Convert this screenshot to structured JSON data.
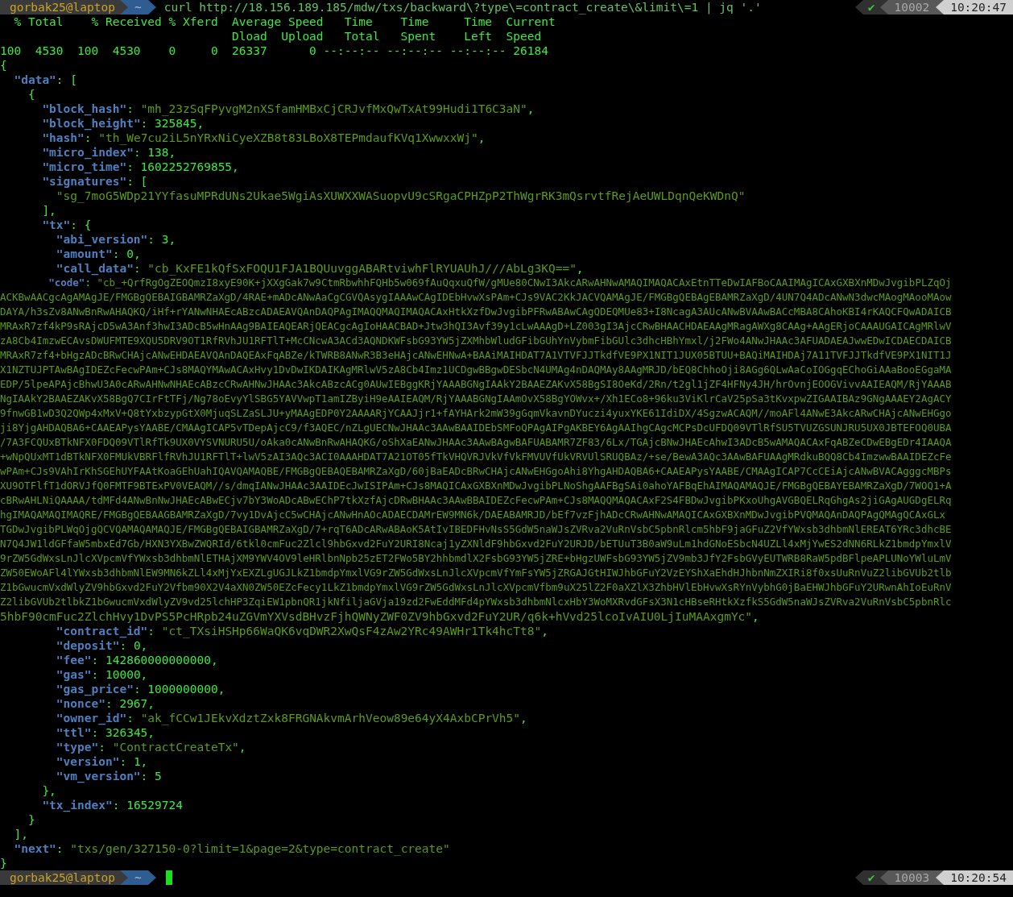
{
  "terminal": {
    "lines": [
      {
        "kind": "prompt",
        "user": "gorbak25@laptop",
        "cwd": "~",
        "command": "curl http://18.156.189.185/mdw/txs/backward\\?type\\=contract_create\\&limit\\=1 | jq '.'",
        "status_icon": "✔",
        "history_number": "10002",
        "time": "10:20:47",
        "cursor": false
      },
      {
        "kind": "output",
        "segments": [
          {
            "kind": "text",
            "text": "  % Total    % Received % Xferd  Average Speed   Time    Time     Time  Current"
          }
        ]
      },
      {
        "kind": "output",
        "segments": [
          {
            "kind": "text",
            "text": "                                 Dload  Upload   Total   Spent    Left  Speed"
          }
        ]
      },
      {
        "kind": "output",
        "segments": [
          {
            "kind": "text",
            "text": "100  4530  100  4530    0     0  26337      0 --:--:-- --:--:-- --:--:-- 26184"
          }
        ]
      },
      {
        "kind": "output",
        "segments": [
          {
            "kind": "text",
            "text": "{"
          }
        ]
      },
      {
        "kind": "output",
        "segments": [
          {
            "kind": "key",
            "text": "  \"data\""
          },
          {
            "kind": "text",
            "text": ": ["
          }
        ]
      },
      {
        "kind": "output",
        "segments": [
          {
            "kind": "text",
            "text": "    {"
          }
        ]
      },
      {
        "kind": "output",
        "segments": [
          {
            "kind": "key",
            "text": "      \"block_hash\""
          },
          {
            "kind": "text",
            "text": ": "
          },
          {
            "kind": "string",
            "text": "\"mh_23zSqFPyvgM2nXSfamHMBxCjCRJvfMxQwTxAt99Hudi1T6C3aN\""
          },
          {
            "kind": "text",
            "text": ","
          }
        ]
      },
      {
        "kind": "output",
        "segments": [
          {
            "kind": "key",
            "text": "      \"block_height\""
          },
          {
            "kind": "text",
            "text": ": 325845,"
          }
        ]
      },
      {
        "kind": "output",
        "segments": [
          {
            "kind": "key",
            "text": "      \"hash\""
          },
          {
            "kind": "text",
            "text": ": "
          },
          {
            "kind": "string",
            "text": "\"th_We7cu2iL5nYRxNiCyeXZB8t83LBoX8TEPmdaufKVq1XwwxxWj\""
          },
          {
            "kind": "text",
            "text": ","
          }
        ]
      },
      {
        "kind": "output",
        "segments": [
          {
            "kind": "key",
            "text": "      \"micro_index\""
          },
          {
            "kind": "text",
            "text": ": 138,"
          }
        ]
      },
      {
        "kind": "output",
        "segments": [
          {
            "kind": "key",
            "text": "      \"micro_time\""
          },
          {
            "kind": "text",
            "text": ": 1602252769855,"
          }
        ]
      },
      {
        "kind": "output",
        "segments": [
          {
            "kind": "key",
            "text": "      \"signatures\""
          },
          {
            "kind": "text",
            "text": ": ["
          }
        ]
      },
      {
        "kind": "output",
        "segments": [
          {
            "kind": "string",
            "text": "        \"sg_7moG5WDp21YYfasuMPRdUNs2Ukae5WgiAsXUWXXWASuopvU9cSRgaCPHZpP2ThWgrRK3mQsrvtfRejAeUWLDqnQeKWDnQ\""
          }
        ]
      },
      {
        "kind": "output",
        "segments": [
          {
            "kind": "text",
            "text": "      ],"
          }
        ]
      },
      {
        "kind": "output",
        "segments": [
          {
            "kind": "key",
            "text": "      \"tx\""
          },
          {
            "kind": "text",
            "text": ": {"
          }
        ]
      },
      {
        "kind": "output",
        "segments": [
          {
            "kind": "key",
            "text": "        \"abi_version\""
          },
          {
            "kind": "text",
            "text": ": 3,"
          }
        ]
      },
      {
        "kind": "output",
        "segments": [
          {
            "kind": "key",
            "text": "        \"amount\""
          },
          {
            "kind": "text",
            "text": ": 0,"
          }
        ]
      },
      {
        "kind": "output",
        "segments": [
          {
            "kind": "key",
            "text": "        \"call_data\""
          },
          {
            "kind": "text",
            "text": ": "
          },
          {
            "kind": "string",
            "text": "\"cb_KxFE1kQfSxFOQU1FJA1BQUuvggABARtviwhFlRYUAUhJ///AbLg3KQ==\""
          },
          {
            "kind": "text",
            "text": ","
          }
        ]
      },
      {
        "kind": "output",
        "segments": [
          {
            "kind": "key",
            "text": "        \"code\""
          },
          {
            "kind": "text",
            "text": ": "
          },
          {
            "kind": "string",
            "text": "\"cb_+QrfRgOgZEOQmzI8xyE90K+jXXgGak7w9CtmRbwhhFQHb5w069fAuQqxuQfW/gMUe80CNwI3AkcARwAHNwAMAQIMAQACAxEtnTTeDwIAFBoCAAIMAgICAxGXBXnMDwJvgibPLZqOj"
          }
        ]
      },
      {
        "kind": "output",
        "segments": [
          {
            "kind": "string",
            "text": "ACKBwAACgcAgAMAgJE/FMGBgQEBAIGBAMRZaXgD/4RAE+mADcANwAaCgCGVQAsygIAAAwCAgIDEbHvwXsPAm+CJs9VAC2KkJACVQAMAgJE/FMGBgQEBAgEBAMRZaXgD/4UN7Q4ADcANwN3dwcMAogMAooMAow"
          }
        ]
      },
      {
        "kind": "output",
        "segments": [
          {
            "kind": "string",
            "text": "DAYA/h3sZv8ANwBnRwAHAQKQ/iHf+rYANwNHAEcABzcADAEAVQAnDAQPAgIMAQQMAQIMAQACAxHtkXzfDwJvgibPFRwABAwCAgQDEQMUe83+I8NcagA3AUcANwBVAAwBACcMBA8CAhoKBI4rKAQCFQwADAICB"
          }
        ]
      },
      {
        "kind": "output",
        "segments": [
          {
            "kind": "string",
            "text": "MRAxR7zf4kP9sRAjcD5wA3Anf3hwI3ADcB5wHnAAg9BAIEAQEARjQEACgcAgIoHAACBAD+Jtw3hQI3Avf39y1cLwAAAgD+LZ003gI3AjcCRwBHAACHDAEAAgMRagAWXg8CAAg+AAgERjoCAAAUGAICAgMRlwV"
          }
        ]
      },
      {
        "kind": "output",
        "segments": [
          {
            "kind": "string",
            "text": "zA8Cb4ImzwECAvsDWUFMTE9XQU5DRV9OT1RfRVhJU1RFTlT+McCNcwA3ACd3AQNDKWFsbG93YW5jZXMhbWludGFibGUhYnVybmFibGUlc3dhcHBhYmxl/j2FWo4ANwJHAAc3AFUADAEAJwwEDwICDAECDAICB"
          }
        ]
      },
      {
        "kind": "output",
        "segments": [
          {
            "kind": "string",
            "text": "MRAxR7zf4+bHgzADcBRwCHAjcANwEHDAEAVQAnDAQEAxFqABZe/kTWRB8ANwR3B3eHAjcANwEHNwA+BAAiMAIHDAT7A1VTVFJJTkdfVE9PX1NIT1JUX05BTUU+BAQiMAIHDAj7A11TVFJJTkdfVE9PX1NIT1J"
          }
        ]
      },
      {
        "kind": "output",
        "segments": [
          {
            "kind": "string",
            "text": "X1NZTUJPTAwBAgIDEZcFecwPAm+CJs8MAQYMAwACAxHvy1DvDwIKDAIKAgMRlwV5zA8Cb4Imz1UCDgwBBgwDESbcN4UMAg4nDAQMAy8AAgMRJD/bEQ8ChhoOji8AGg6QLwAaCoIOGgqEChoGiAAaBooEGgaMA"
          }
        ]
      },
      {
        "kind": "output",
        "segments": [
          {
            "kind": "string",
            "text": "EDP/5lpeAPAjcBhwU3A0cARwAHNwNHAEcABzcCRwAHNwJHAAc3AkcABzcACg0AUwIEBggKRjYAAABGNgIAAkY2BAAEZAKvX58BgSI8OeKd/2Rn/t2gl1jZF4HFNy4JH/hrOvnjEOOGVivvAAIEAQM/RjYAAAB"
          }
        ]
      },
      {
        "kind": "output",
        "segments": [
          {
            "kind": "string",
            "text": "NgIAAkY2BAAEZAKvX58BgQ7CIrFtTFj/Ng78oEvyYlSBG5YAVVwpT1amIZByiH9eAAIEAQM/RjYAAABGNgIAAmOvX58BgYOWvx+/Xh1ECo8+96ku3ViKlrCaV25pSa3tKvxpwZIGAAIBAz9GNgAAAEY2AgACY"
          }
        ]
      },
      {
        "kind": "output",
        "segments": [
          {
            "kind": "string",
            "text": "9fnwGB1wD3Q2QWp4xMxV+Q8tYxbzypGtX0MjuqSLZaSLJU+yMAAgEDP0Y2AAAARjYCAAJjr1+fAYHArk2mW39gGqmVkavnDYuczi4yuxYKE61IdiDX/4SgzwACAQM//moAFl4ANwE3AkcARwCHAjcANwEHGgo"
          }
        ]
      },
      {
        "kind": "output",
        "segments": [
          {
            "kind": "string",
            "text": "ji8YjgAHDAQBA6+CAAEAPysYAABE/CMAAgICAP5vTDepAjcC9/f3AQEC/nZLgUECNwJHAAc3AAwBAAIDEbSMFoQPAgAIPgAKBEY6AgAAIhgCAgcMCPsDcUFDQ09VTlRfSU5TVUZGSUNJRU5UX0JBTEFOQ0UBA"
          }
        ]
      },
      {
        "kind": "output",
        "segments": [
          {
            "kind": "string",
            "text": "/7A3FCQUxBTkNFX0FDQ09VTlRfTk9UX0VYSVNURU5U/oAka0cANwBnRwAHAQKG/oShXaEANwJHAAc3AAwBAgwBAFUABAMR7ZF83/6Lx/TGAjcBNwJHAEcAhwI3ADcB5wAMAQACAxFqABZeCDwEBgEDr4IAAQA"
          }
        ]
      },
      {
        "kind": "output",
        "segments": [
          {
            "kind": "string",
            "text": "+wNpQUxMT1dBTkNFX0FMUkVBRFlfRVhJU1RFTlT+lwV5zAI3AQc3ACI0AAAHDAT7A21OT05fTkVHQVRJVkVfVkFMVUVfUkVRVUlSRUQBAz/+se/BewA3AQc3AAwBAFUAAgMRdkuBQQ8Cb4ImzwwBAAIDEZcFe"
          }
        ]
      },
      {
        "kind": "output",
        "segments": [
          {
            "kind": "string",
            "text": "wPAm+CJs9VAhIrKhSGEhUYFAAtKoaGEhUahIQAVQAMAQBE/FMGBgQEBAQEBAMRZaXgD/60jBaEADcBRwCHAjcANwEHGgoAhi8YhgAHDAQBA6+CAAEAPysYAABE/CMAAgICAP7CcCEiAjcANwBVACAgggcMBPs"
          }
        ]
      },
      {
        "kind": "output",
        "segments": [
          {
            "kind": "string",
            "text": "XU9OTFlfT1dORVJfQ0FMTF9BTExPV0VEAQM//s/dmqIANwJHAAc3AAIDEcJwISIPAm+CJs8MAQICAxGXBXnMDwJvgibPLNoShgAAFBgSAi0ahoYAFBqEhAIMAQAMAQJE/FMGBgQEBAYEBAMRZaXgD/7WOQ1+A"
          }
        ]
      },
      {
        "kind": "output",
        "segments": [
          {
            "kind": "string",
            "text": "cBRwAHLNiQAAAA/tdMFd4ANwBnNwJHAEcABwECjv7bY3WoADcABwEChP7tkXzfAjcDRwBHAAc3AAwBBAIDEZcFecwPAm+CJs8MAQQMAQACAxF2S4FBDwJvgibPKxoUhgAVGBQELRqGhgAs2jiGAgAUGDgELRq"
          }
        ]
      },
      {
        "kind": "output",
        "segments": [
          {
            "kind": "string",
            "text": "hgIMAQAMAQIMAQRE/FMGBgQEBAAGBAMRZaXgD/7vy1DvAjcC5wCHAjcANwHnAOcADAECDAMrEW9MN6k/DAEABAMRJD/bEf7vzFjhADcCRwAHNwAMAQICAxGXBXnMDwJvgibPVQMAQAnDAQPAgQMAgQCAxGLx"
          }
        ]
      },
      {
        "kind": "output",
        "segments": [
          {
            "kind": "string",
            "text": "TGDwJvgibPLWqOjgQCVQAMAQAMAQJE/FMGBgQEBAIGBAMRZaXgD/7+rqT6ADcARwABAoK5AtIvIBEDFHvNsS5GdW5naWJsZVRva2VuRnVsbC5pbnRlcm5hbF9jaGFuZ2VfYWxsb3dhbmNlEREAT6YRc3dhcBE"
          }
        ]
      },
      {
        "kind": "output",
        "segments": [
          {
            "kind": "string",
            "text": "N7Q4JW1ldGFfaW5mbxEd7Gb/HXN3YXBwZWQRId/6tkl0cmFuc2Zlcl9hbGxvd2FuY2URI8Ncaj1yZXNldF9hbGxvd2FuY2URJD/bETUuT3B0aW9uLm1hdGNoESbcN4UZLl4xMjYwES2dNN6RLkZ1bmdpYmxlV"
          }
        ]
      },
      {
        "kind": "output",
        "segments": [
          {
            "kind": "string",
            "text": "9rZW5GdWxsLnJlcXVpcmVfYWxsb3dhbmNlETHAjXM9YWV4OV9leHRlbnNpb25zET2FWo5BY2hhbmdlX2FsbG93YW5jZRE+bHgzUWFsbG93YW5jZV9mb3JfY2FsbGVyEUTWRB8RaW5pdBFlpeAPLUNoYWluLmV"
          }
        ]
      },
      {
        "kind": "output",
        "segments": [
          {
            "kind": "string",
            "text": "ZW50EWoAFl4lYWxsb3dhbmNlEW9MN6kZLl4xMjYxEXZLgUGJLkZ1bmdpYmxlVG9rZW5GdWxsLnJlcXVpcmVfYmFsYW5jZRGAJGtHIWJhbGFuY2VzEYShXaEhdHJhbnNmZXIRi8f0xsUuRnVuZ2libGVUb2tlb"
          }
        ]
      },
      {
        "kind": "output",
        "segments": [
          {
            "kind": "string",
            "text": "Z1bGwucmVxdWlyZV9hbGxvd2FuY2Vfbm90X2V4aXN0ZW50EZcFecy1LkZ1bmdpYmxlVG9rZW5GdWxsLnJlcXVpcmVfbm9uX25lZ2F0aXZlX3ZhbHVlEbHvwXsRYnVybhG0jBaEHWJhbGFuY2URwnAhIoEuRnV"
          }
        ]
      },
      {
        "kind": "output",
        "segments": [
          {
            "kind": "string",
            "text": "Z2libGVUb2tlbkZ1bGwucmVxdWlyZV9vd25lchHP3ZqiEW1pbnQR1jkNfiljaGVja19zd2FwEddMFd4pYWxsb3dhbmNlcxHbY3WoMXRvdGFsX3N1cHBseRHtkXzfkS5GdW5naWJsZVRva2VuRnVsbC5pbnRlc"
          }
        ]
      },
      {
        "kind": "output",
        "segments": [
          {
            "kind": "string",
            "text": "5hbF90cmFuc2ZlchHvy1DvPS5PcHRpb24uZGVmYXVsdBHvzFjhQWNyZWF0ZV9hbGxvd2FuY2UR/q6k+hVvd25lcoIvAIU0LjIuMAAxgmYc\""
          },
          {
            "kind": "text",
            "text": ","
          }
        ]
      },
      {
        "kind": "output",
        "segments": [
          {
            "kind": "key",
            "text": "        \"contract_id\""
          },
          {
            "kind": "text",
            "text": ": "
          },
          {
            "kind": "string",
            "text": "\"ct_TXsiHSHp66WaQK6vqDWR2XwQsF4zAw2YRc49AWHr1Tk4hcTt8\""
          },
          {
            "kind": "text",
            "text": ","
          }
        ]
      },
      {
        "kind": "output",
        "segments": [
          {
            "kind": "key",
            "text": "        \"deposit\""
          },
          {
            "kind": "text",
            "text": ": 0,"
          }
        ]
      },
      {
        "kind": "output",
        "segments": [
          {
            "kind": "key",
            "text": "        \"fee\""
          },
          {
            "kind": "text",
            "text": ": 142860000000000,"
          }
        ]
      },
      {
        "kind": "output",
        "segments": [
          {
            "kind": "key",
            "text": "        \"gas\""
          },
          {
            "kind": "text",
            "text": ": 10000,"
          }
        ]
      },
      {
        "kind": "output",
        "segments": [
          {
            "kind": "key",
            "text": "        \"gas_price\""
          },
          {
            "kind": "text",
            "text": ": 1000000000,"
          }
        ]
      },
      {
        "kind": "output",
        "segments": [
          {
            "kind": "key",
            "text": "        \"nonce\""
          },
          {
            "kind": "text",
            "text": ": 2967,"
          }
        ]
      },
      {
        "kind": "output",
        "segments": [
          {
            "kind": "key",
            "text": "        \"owner_id\""
          },
          {
            "kind": "text",
            "text": ": "
          },
          {
            "kind": "string",
            "text": "\"ak_fCCw1JEkvXdztZxk8FRGNAkvmArhVeow89e64yX4AxbCPrVh5\""
          },
          {
            "kind": "text",
            "text": ","
          }
        ]
      },
      {
        "kind": "output",
        "segments": [
          {
            "kind": "key",
            "text": "        \"ttl\""
          },
          {
            "kind": "text",
            "text": ": 326345,"
          }
        ]
      },
      {
        "kind": "output",
        "segments": [
          {
            "kind": "key",
            "text": "        \"type\""
          },
          {
            "kind": "text",
            "text": ": "
          },
          {
            "kind": "string",
            "text": "\"ContractCreateTx\""
          },
          {
            "kind": "text",
            "text": ","
          }
        ]
      },
      {
        "kind": "output",
        "segments": [
          {
            "kind": "key",
            "text": "        \"version\""
          },
          {
            "kind": "text",
            "text": ": 1,"
          }
        ]
      },
      {
        "kind": "output",
        "segments": [
          {
            "kind": "key",
            "text": "        \"vm_version\""
          },
          {
            "kind": "text",
            "text": ": 5"
          }
        ]
      },
      {
        "kind": "output",
        "segments": [
          {
            "kind": "text",
            "text": "      },"
          }
        ]
      },
      {
        "kind": "output",
        "segments": [
          {
            "kind": "key",
            "text": "      \"tx_index\""
          },
          {
            "kind": "text",
            "text": ": 16529724"
          }
        ]
      },
      {
        "kind": "output",
        "segments": [
          {
            "kind": "text",
            "text": "    }"
          }
        ]
      },
      {
        "kind": "output",
        "segments": [
          {
            "kind": "text",
            "text": "  ],"
          }
        ]
      },
      {
        "kind": "output",
        "segments": [
          {
            "kind": "key",
            "text": "  \"next\""
          },
          {
            "kind": "text",
            "text": ": "
          },
          {
            "kind": "string",
            "text": "\"txs/gen/327150-0?limit=1&page=2&type=contract_create\""
          }
        ]
      },
      {
        "kind": "output",
        "segments": [
          {
            "kind": "text",
            "text": "}"
          }
        ]
      },
      {
        "kind": "prompt",
        "user": "gorbak25@laptop",
        "cwd": "~",
        "status_icon": "✔",
        "history_number": "10003",
        "time": "10:20:54",
        "cursor": true
      }
    ]
  }
}
